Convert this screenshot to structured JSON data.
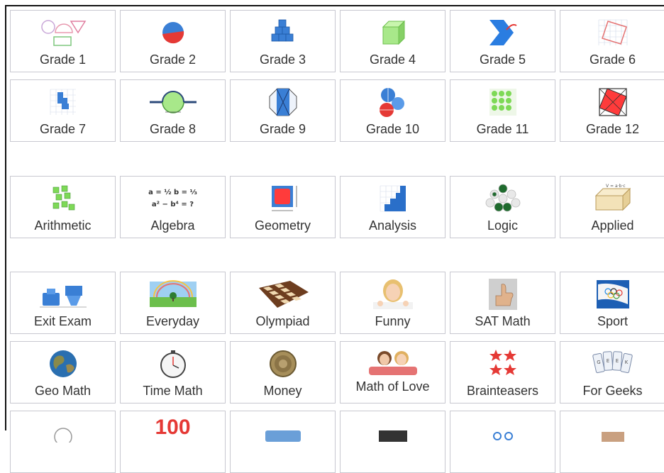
{
  "grades": [
    {
      "label": "Grade 1",
      "icon": "shapes-icon"
    },
    {
      "label": "Grade 2",
      "icon": "half-circle-icon"
    },
    {
      "label": "Grade 3",
      "icon": "cubes-icon"
    },
    {
      "label": "Grade 4",
      "icon": "cube-icon"
    },
    {
      "label": "Grade 5",
      "icon": "arrow-chevron-icon"
    },
    {
      "label": "Grade 6",
      "icon": "rotated-square-grid-icon"
    },
    {
      "label": "Grade 7",
      "icon": "grid-blocks-icon"
    },
    {
      "label": "Grade 8",
      "icon": "circle-segment-icon"
    },
    {
      "label": "Grade 9",
      "icon": "octagon-square-icon"
    },
    {
      "label": "Grade 10",
      "icon": "spheres-icon"
    },
    {
      "label": "Grade 11",
      "icon": "dot-grid-icon"
    },
    {
      "label": "Grade 12",
      "icon": "inscribed-square-icon"
    }
  ],
  "topics": [
    {
      "label": "Arithmetic",
      "icon": "number-blocks-icon"
    },
    {
      "label": "Algebra",
      "icon": "formula-icon"
    },
    {
      "label": "Geometry",
      "icon": "square-measure-icon"
    },
    {
      "label": "Analysis",
      "icon": "staircase-graph-icon"
    },
    {
      "label": "Logic",
      "icon": "hexagon-pattern-icon"
    },
    {
      "label": "Applied",
      "icon": "box-volume-icon"
    }
  ],
  "themes": [
    {
      "label": "Exit Exam",
      "icon": "containers-icon"
    },
    {
      "label": "Everyday",
      "icon": "landscape-icon"
    },
    {
      "label": "Olympiad",
      "icon": "chessboard-icon"
    },
    {
      "label": "Funny",
      "icon": "girl-photo-icon"
    },
    {
      "label": "SAT Math",
      "icon": "thumbs-up-icon"
    },
    {
      "label": "Sport",
      "icon": "olympic-flag-icon"
    },
    {
      "label": "Geo Math",
      "icon": "globe-icon"
    },
    {
      "label": "Time Math",
      "icon": "stopwatch-icon"
    },
    {
      "label": "Money",
      "icon": "coin-icon"
    },
    {
      "label": "Math of Love",
      "icon": "couple-photo-icon"
    },
    {
      "label": "Brainteasers",
      "icon": "stars-icon"
    },
    {
      "label": "For Geeks",
      "icon": "geek-cards-icon"
    }
  ],
  "icon_texts": {
    "algebra_line1": "a = ½   b = ⅓",
    "algebra_line2": "a² − b⁴ = ?",
    "applied_formula": "V = a·b·c",
    "geeks_letters": "GEEK",
    "partial_number": "100"
  },
  "colors": {
    "border": "#c8c8d0",
    "label": "#333333",
    "blue": "#3a7fd5",
    "red": "#e53935",
    "green": "#7ed957"
  }
}
